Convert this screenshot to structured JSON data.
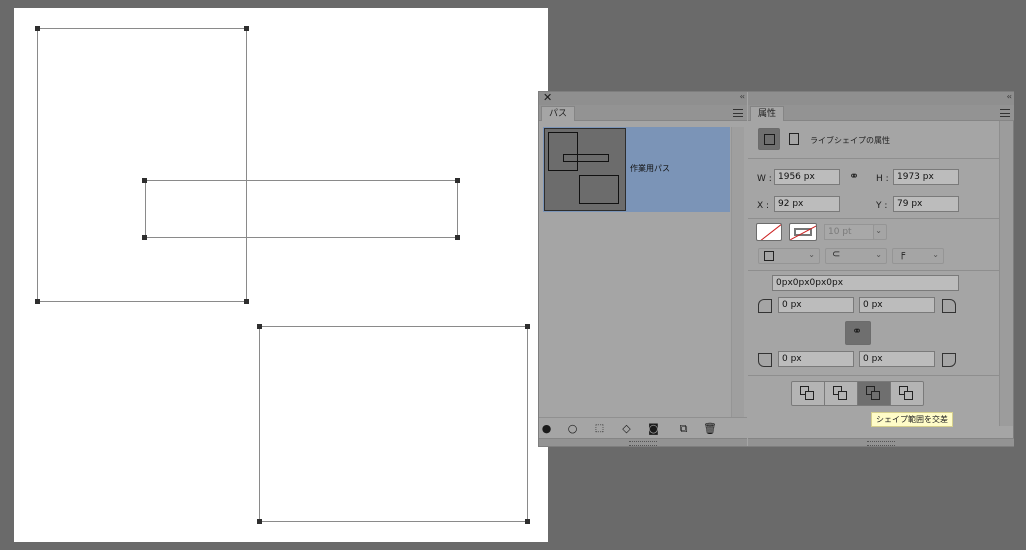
{
  "paths_panel": {
    "tab": "パス",
    "items": [
      {
        "label": "作業用パス"
      }
    ],
    "footer_icons": [
      "fill-path-icon",
      "stroke-path-icon",
      "load-selection-icon",
      "make-work-path-icon",
      "add-mask-icon",
      "new-path-icon",
      "trash-icon"
    ]
  },
  "properties_panel": {
    "tab": "属性",
    "header_title": "ライブシェイプの属性",
    "transform": {
      "w_label": "W :",
      "w_value": "1956 px",
      "h_label": "H :",
      "h_value": "1973 px",
      "x_label": "X :",
      "x_value": "92 px",
      "y_label": "Y :",
      "y_value": "79 px"
    },
    "stroke": {
      "width_value": "10 pt"
    },
    "corners": {
      "combined": "0px0px0px0px",
      "top_left": "0 px",
      "top_right": "0 px",
      "bottom_left": "0 px",
      "bottom_right": "0 px"
    },
    "tooltip": "シェイプ範囲を交差"
  },
  "colors": {
    "workspace": "#6a6a6a",
    "panel": "#a5a5a5",
    "selected_row": "#7b94b7",
    "tooltip_bg": "#fffcc8"
  }
}
